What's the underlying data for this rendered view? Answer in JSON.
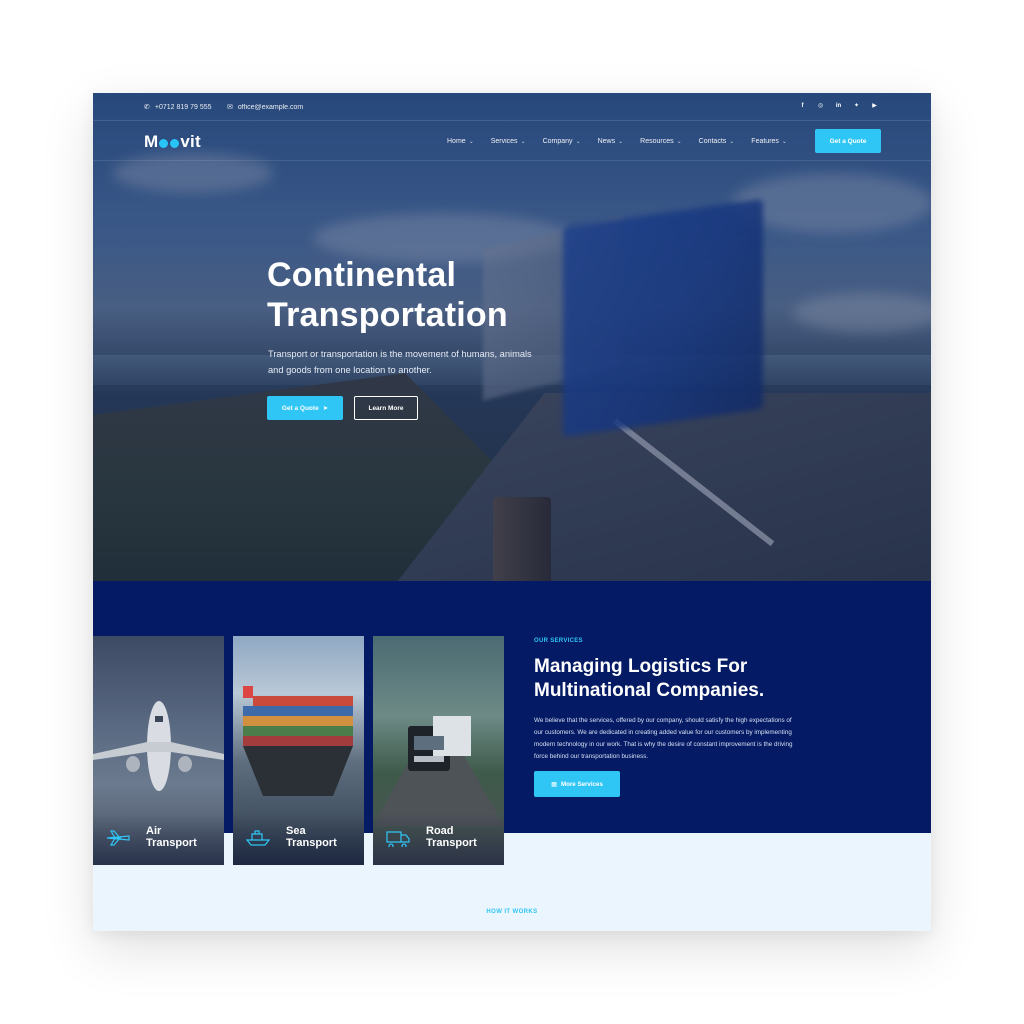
{
  "topbar": {
    "phone": "+0712 819 79 555",
    "email": "office@example.com",
    "social": [
      "facebook-icon",
      "instagram-icon",
      "linkedin-icon",
      "twitter-icon",
      "youtube-icon"
    ]
  },
  "brand": {
    "logo_prefix": "M",
    "logo_suffix": "vit"
  },
  "nav": {
    "items": [
      {
        "label": "Home"
      },
      {
        "label": "Services"
      },
      {
        "label": "Company"
      },
      {
        "label": "News"
      },
      {
        "label": "Resources"
      },
      {
        "label": "Contacts"
      },
      {
        "label": "Features"
      }
    ],
    "cta": "Get a Quote"
  },
  "hero": {
    "title_line1": "Continental",
    "title_line2": "Transportation",
    "subtitle": "Transport or transportation is the movement of humans, animals and goods from one location to another.",
    "primary_btn": "Get a Quote",
    "secondary_btn": "Learn More"
  },
  "services": {
    "eyebrow": "OUR SERVICES",
    "title_line1": "Managing Logistics For",
    "title_line2": "Multinational Companies.",
    "text": "We believe that the services, offered by our company, should satisfy the high expectations of our customers. We are dedicated in creating added value for our customers by implementing modern technology in our work. That is why the desire of constant improvement is the driving force behind our transportation business.",
    "button": "More Services",
    "cards": [
      {
        "line1": "Air",
        "line2": "Transport",
        "icon": "airplane-icon"
      },
      {
        "line1": "Sea",
        "line2": "Transport",
        "icon": "ship-icon"
      },
      {
        "line1": "Road",
        "line2": "Transport",
        "icon": "truck-icon"
      }
    ]
  },
  "how": {
    "label": "HOW IT WORKS"
  },
  "colors": {
    "accent": "#2fc6f6",
    "navy": "#041a64"
  }
}
